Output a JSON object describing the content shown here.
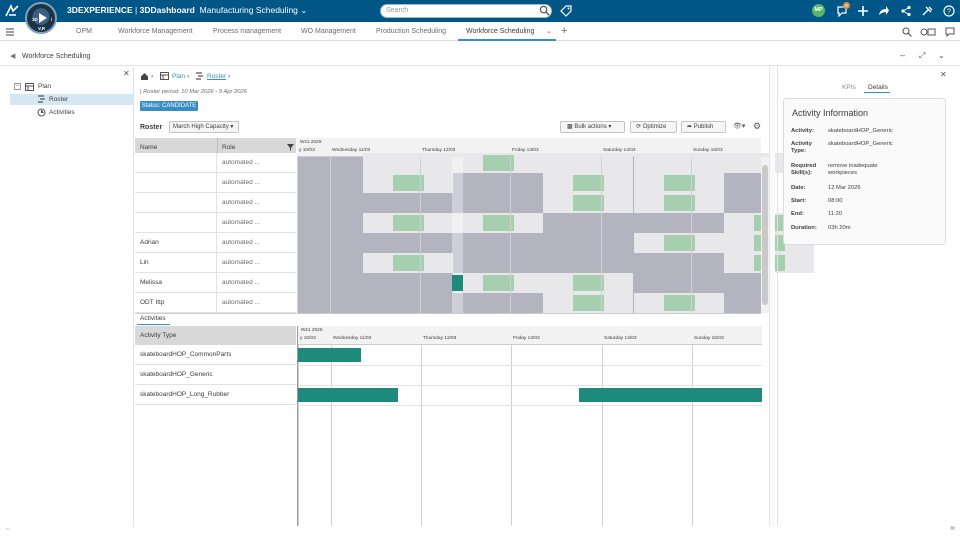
{
  "topbar": {
    "brand": "3DEXPERIENCE",
    "dashboard": "3DDashboard",
    "app": "Manufacturing Scheduling",
    "search_placeholder": "Search",
    "user_initials": "MP",
    "notification_count": "9",
    "compass_labels": {
      "top": "3D",
      "left": "V,R",
      "right": "i"
    }
  },
  "tabs": [
    {
      "label": "OPM"
    },
    {
      "label": "Workforce Management"
    },
    {
      "label": "Process management"
    },
    {
      "label": "WO Management"
    },
    {
      "label": "Production Scheduling"
    },
    {
      "label": "Workforce Scheduling",
      "active": true
    }
  ],
  "panel": {
    "title": "Workforce Scheduling"
  },
  "tree": {
    "root": "Plan",
    "items": [
      "Roster",
      "Activities"
    ]
  },
  "breadcrumb": {
    "plan": "Plan",
    "roster": "Roster"
  },
  "roster_period": "| Roster period: 10 Mar 2026 - 9 Apr 2026",
  "status": "Status: CANDIDATE",
  "toolbar": {
    "roster_label": "Roster",
    "roster_select": "March High Capacity",
    "bulk_actions": "Bulk actions",
    "optimize": "Optimize",
    "publish": "Publish"
  },
  "roster_grid": {
    "col_name": "Name",
    "col_role": "Role",
    "rows": [
      {
        "name": "",
        "role": "automated ..."
      },
      {
        "name": "",
        "role": "automated ..."
      },
      {
        "name": "",
        "role": "automated ..."
      },
      {
        "name": "",
        "role": "automated ..."
      },
      {
        "name": "Adrian",
        "role": "automated ..."
      },
      {
        "name": "Lin",
        "role": "automated ..."
      },
      {
        "name": "Melissa",
        "role": "automated ..."
      },
      {
        "name": "ODT Ittp",
        "role": "automated ..."
      }
    ]
  },
  "timeline": {
    "week": "W11 2026",
    "days": [
      "y 10/03",
      "Wednesday 11/03",
      "Thursday 12/03",
      "Friday 13/03",
      "Saturday 14/03",
      "Sunday 15/03"
    ]
  },
  "activities_tab": "Activities",
  "activity_grid": {
    "col_type": "Activity Type",
    "rows": [
      "skateboardHOP_CommonParts",
      "skateboardHOP_Generic",
      "skateboardHOP_Long_Rubber"
    ]
  },
  "right_panel": {
    "tabs": [
      "KPIs",
      "Details"
    ],
    "title": "Activity Information",
    "fields": [
      {
        "k": "Activity:",
        "v": "skateboardHOP_Generic"
      },
      {
        "k": "Activity Type:",
        "v": "skateboardHOP_Generic"
      },
      {
        "k": "Required Skill(s):",
        "v": "remove inadequate\nworkpieces"
      },
      {
        "k": "Date:",
        "v": "12 Mar 2026"
      },
      {
        "k": "Start:",
        "v": "08:00"
      },
      {
        "k": "End:",
        "v": "11:20"
      },
      {
        "k": "Duration:",
        "v": "03h 20m"
      }
    ]
  },
  "colors": {
    "topbar": "#005686",
    "accent": "#368ec4",
    "activity": "#1d8a7b",
    "shift": "#a5cfae"
  }
}
